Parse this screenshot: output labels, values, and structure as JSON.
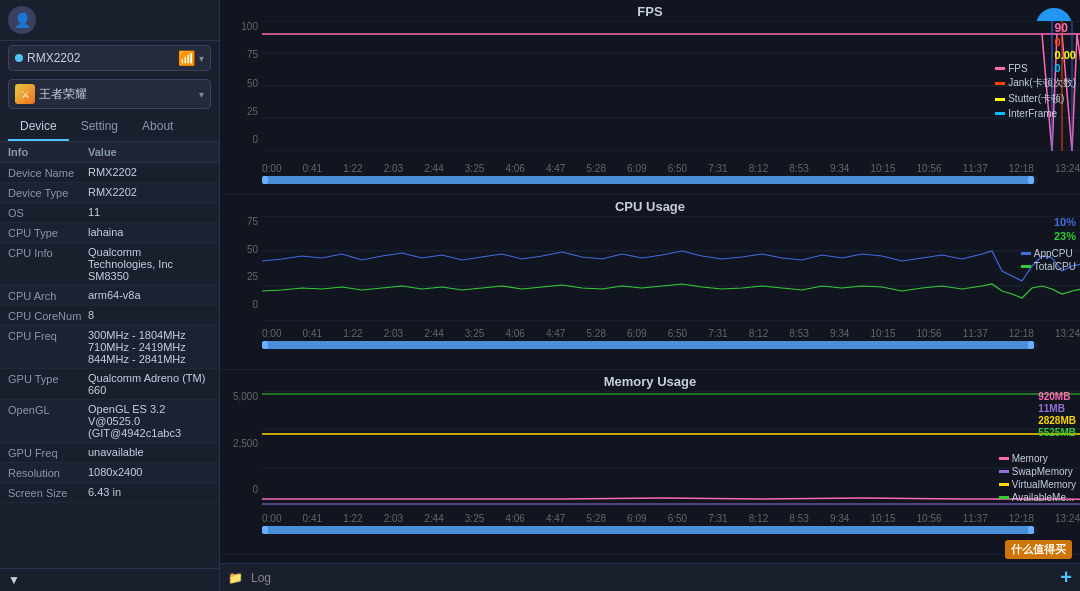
{
  "sidebar": {
    "avatar": "👤",
    "device": {
      "name": "RMX2202",
      "chevron": "▾"
    },
    "game": {
      "label": "王者荣耀",
      "chevron": "▾"
    },
    "tabs": [
      {
        "label": "Device",
        "active": true
      },
      {
        "label": "Setting",
        "active": false
      },
      {
        "label": "About",
        "active": false
      }
    ],
    "table_headers": {
      "info": "Info",
      "value": "Value"
    },
    "rows": [
      {
        "key": "Device Name",
        "value": "RMX2202"
      },
      {
        "key": "Device Type",
        "value": "RMX2202"
      },
      {
        "key": "OS",
        "value": "11"
      },
      {
        "key": "CPU Type",
        "value": "lahaina"
      },
      {
        "key": "CPU Info",
        "value": "Qualcomm Technologies, Inc SM8350"
      },
      {
        "key": "CPU Arch",
        "value": "arm64-v8a"
      },
      {
        "key": "CPU CoreNum",
        "value": "8"
      },
      {
        "key": "CPU Freq",
        "value": "300MHz - 1804MHz\n710MHz - 2419MHz\n844MHz - 2841MHz"
      },
      {
        "key": "GPU Type",
        "value": "Qualcomm Adreno (TM) 660"
      },
      {
        "key": "OpenGL",
        "value": "OpenGL ES 3.2 V@0525.0 (GIT@4942c1abc3"
      },
      {
        "key": "GPU Freq",
        "value": "unavailable"
      },
      {
        "key": "Resolution",
        "value": "1080x2400"
      },
      {
        "key": "Screen Size",
        "value": "6.43 in"
      }
    ],
    "bottom_icon": "▼"
  },
  "charts": {
    "fps": {
      "title": "FPS",
      "y_labels": [
        "100",
        "75",
        "50",
        "25",
        "0"
      ],
      "x_labels": [
        "0:00",
        "0:41",
        "1:22",
        "2:03",
        "2:44",
        "3:25",
        "4:06",
        "4:47",
        "5:28",
        "6:09",
        "6:50",
        "7:31",
        "8:12",
        "8:53",
        "9:34",
        "10:15",
        "10:56",
        "11:37",
        "12:18",
        "13:24"
      ],
      "values": {
        "fps": 90,
        "jank": 0,
        "stutter": "0.00",
        "interframe": 0
      },
      "legend": [
        {
          "label": "FPS",
          "color": "#ff69b4"
        },
        {
          "label": "Jank(卡顿次数)",
          "color": "#ff4500"
        },
        {
          "label": "Stutter(卡顿)",
          "color": "#ffff00"
        },
        {
          "label": "InterFrame",
          "color": "#00bfff"
        }
      ]
    },
    "cpu": {
      "title": "CPU Usage",
      "y_labels": [
        "75",
        "50",
        "25",
        "0"
      ],
      "y_unit": "%",
      "x_labels": [
        "0:00",
        "0:41",
        "1:22",
        "2:03",
        "2:44",
        "3:25",
        "4:06",
        "4:47",
        "5:28",
        "6:09",
        "6:50",
        "7:31",
        "8:12",
        "8:53",
        "9:34",
        "10:15",
        "10:56",
        "11:37",
        "12:18",
        "13:24"
      ],
      "values": {
        "app_cpu": "10%",
        "total_cpu": "23%"
      },
      "legend": [
        {
          "label": "AppCPU",
          "color": "#4169e1"
        },
        {
          "label": "TotalCPU",
          "color": "#32cd32"
        }
      ]
    },
    "memory": {
      "title": "Memory Usage",
      "y_labels": [
        "5,000",
        "2,500",
        "0"
      ],
      "y_unit": "MB",
      "x_labels": [
        "0:00",
        "0:41",
        "1:22",
        "2:03",
        "2:44",
        "3:25",
        "4:06",
        "4:47",
        "5:28",
        "6:09",
        "6:50",
        "7:31",
        "8:12",
        "8:53",
        "9:34",
        "10:15",
        "10:56",
        "11:37",
        "12:18",
        "13:24"
      ],
      "values": {
        "memory": "920MB",
        "swap": "11MB",
        "virtual": "2828MB",
        "available": "5525MB"
      },
      "legend": [
        {
          "label": "Memory",
          "color": "#ff69b4"
        },
        {
          "label": "SwapMemory",
          "color": "#9370db"
        },
        {
          "label": "VirtualMemory",
          "color": "#ffd700"
        },
        {
          "label": "AvailableMe...",
          "color": "#32cd32"
        }
      ]
    }
  },
  "bottom": {
    "log_label": "Log",
    "play_icon": "▶",
    "watermark": "什么值得买",
    "add_icon": "+",
    "folder_icon": "📁"
  }
}
